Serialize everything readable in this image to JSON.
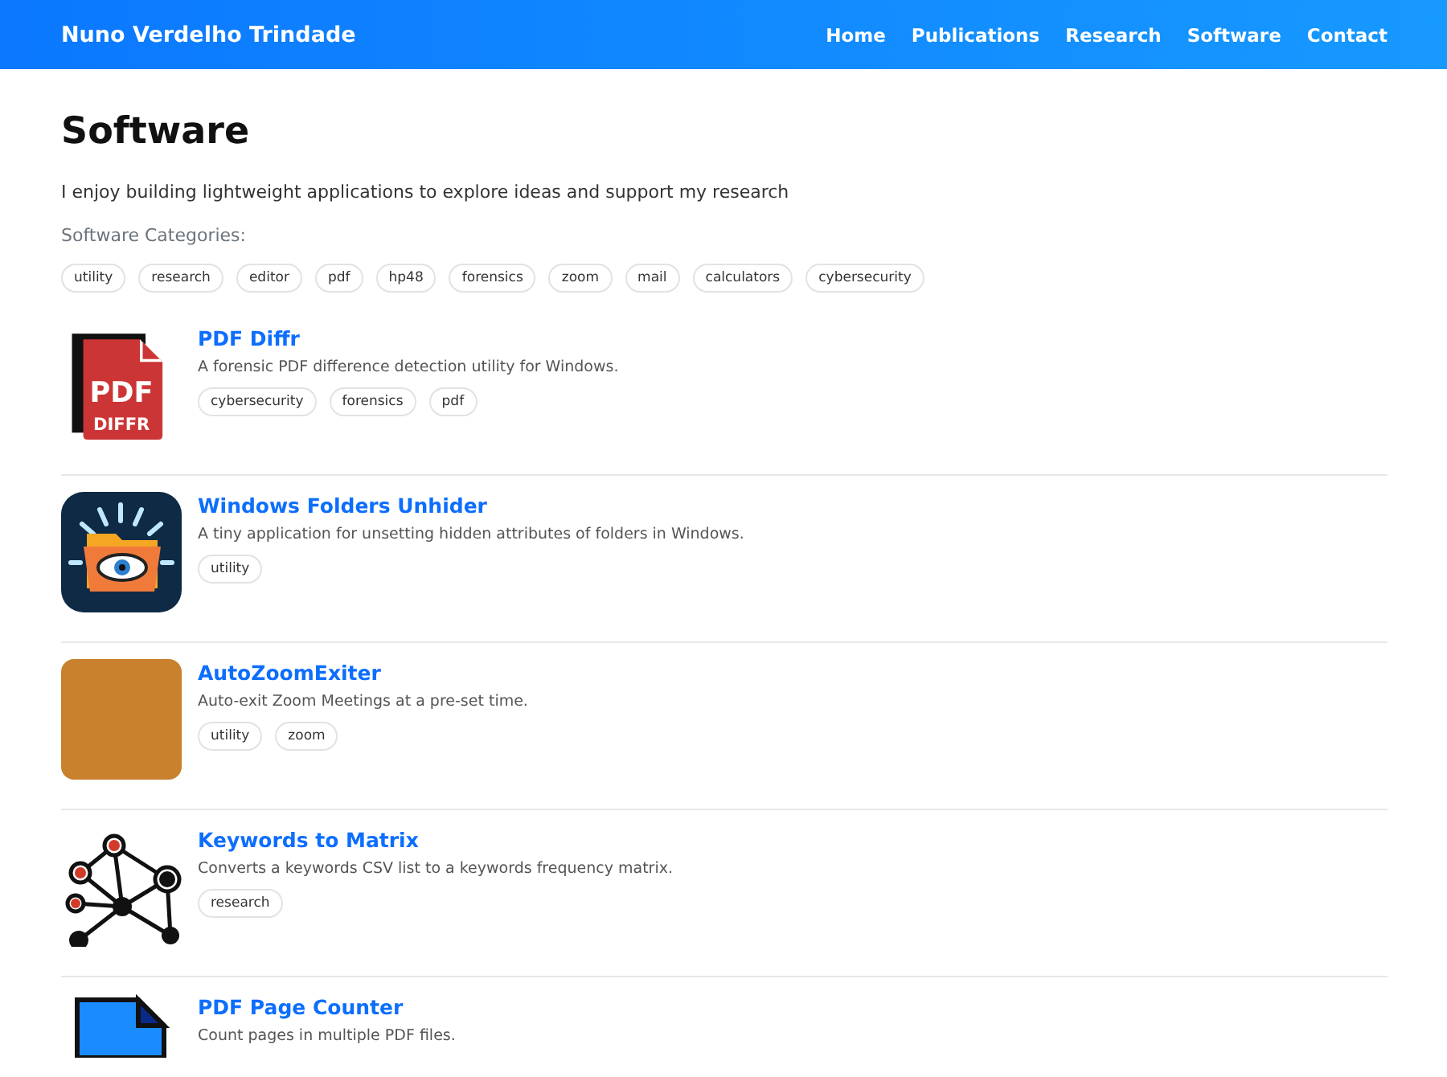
{
  "site": {
    "title": "Nuno Verdelho Trindade",
    "nav": [
      {
        "label": "Home"
      },
      {
        "label": "Publications"
      },
      {
        "label": "Research"
      },
      {
        "label": "Software"
      },
      {
        "label": "Contact"
      }
    ]
  },
  "page": {
    "heading": "Software",
    "intro": "I enjoy building lightweight applications to explore ideas and support my research",
    "categories_label": "Software Categories:",
    "categories": [
      "utility",
      "research",
      "editor",
      "pdf",
      "hp48",
      "forensics",
      "zoom",
      "mail",
      "calculators",
      "cybersecurity"
    ]
  },
  "software": [
    {
      "kind": "pdf-document",
      "icon_text": [
        "PDF",
        "DIFFR"
      ],
      "name": "PDF Diffr",
      "description": "A forensic PDF difference detection utility for Windows.",
      "tags": [
        "cybersecurity",
        "forensics",
        "pdf"
      ]
    },
    {
      "kind": "folder-eye",
      "name": "Windows Folders Unhider",
      "description": "A tiny application for unsetting hidden attributes of folders in Windows.",
      "tags": [
        "utility"
      ]
    },
    {
      "kind": "photo",
      "name": "AutoZoomExiter",
      "description": "Auto-exit Zoom Meetings at a pre-set time.",
      "tags": [
        "utility",
        "zoom"
      ]
    },
    {
      "kind": "network",
      "name": "Keywords to Matrix",
      "description": "Converts a keywords CSV list to a keywords frequency matrix.",
      "tags": [
        "research"
      ]
    },
    {
      "kind": "blue-document",
      "name": "PDF Page Counter",
      "description": "Count pages in multiple PDF files."
    }
  ]
}
